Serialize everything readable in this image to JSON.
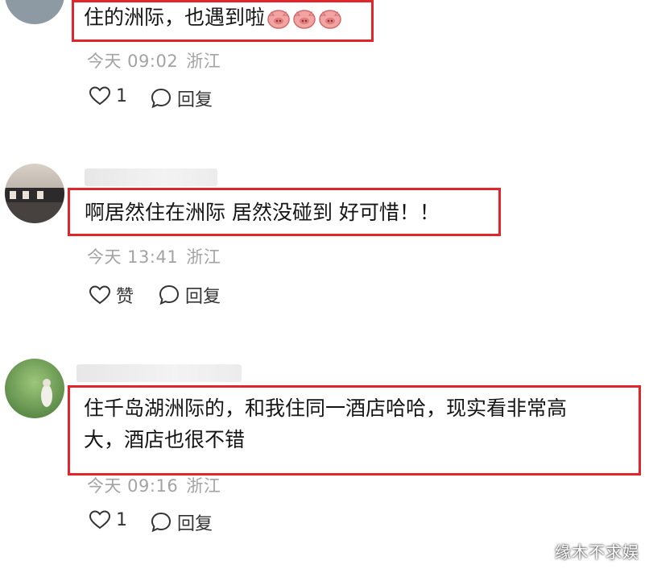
{
  "comments": [
    {
      "text": "住的洲际，也遇到啦",
      "emoji_name": "pig-face-emoji",
      "emoji_count": 3,
      "time": "今天 09:02",
      "location": "浙江",
      "like_label": "1",
      "reply_label": "回复"
    },
    {
      "text": "啊居然住在洲际 居然没碰到 好可惜！！",
      "time": "今天 13:41",
      "location": "浙江",
      "like_label": "赞",
      "reply_label": "回复"
    },
    {
      "text_line1": "住千岛湖洲际的，和我住同一酒店哈哈，现实看非常高",
      "text_line2": "大，酒店也很不错",
      "time": "今天 09:16",
      "location": "浙江",
      "like_label": "1",
      "reply_label": "回复"
    }
  ],
  "watermark": "缘木不求娱",
  "colors": {
    "highlight_border": "#e0262a",
    "meta_text": "#a3a3a3",
    "body_text": "#151515"
  },
  "icons": {
    "like": "heart-outline-icon",
    "reply": "speech-bubble-icon"
  }
}
